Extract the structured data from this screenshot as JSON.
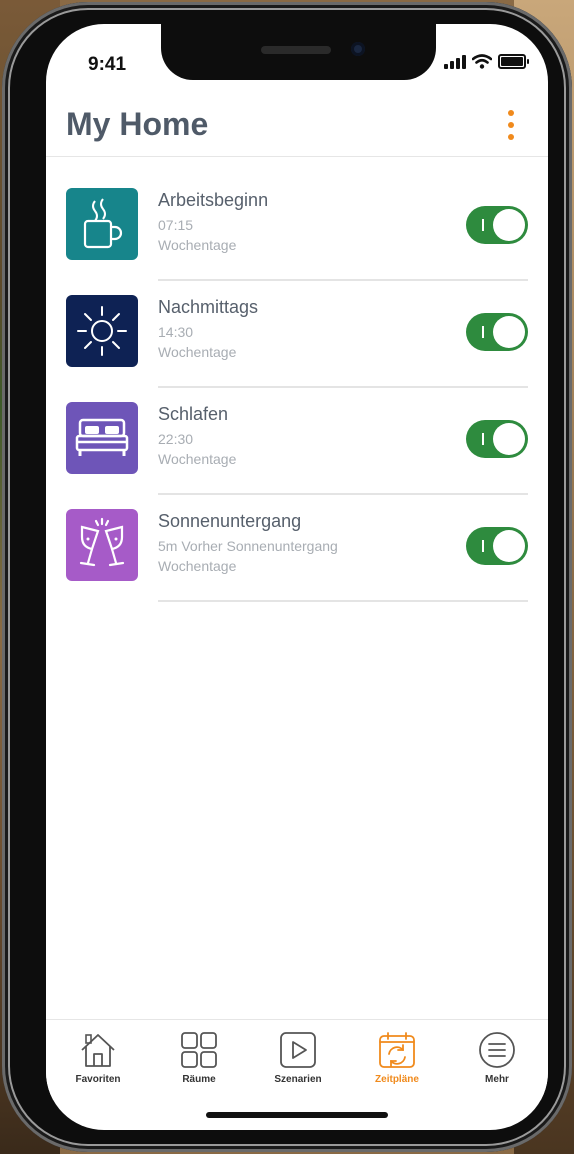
{
  "status_bar": {
    "time": "9:41"
  },
  "header": {
    "title": "My Home"
  },
  "colors": {
    "accent": "#f08a1c",
    "toggle_on": "#2e8b3e",
    "title": "#4f5a68"
  },
  "schedules": [
    {
      "title": "Arbeitsbeginn",
      "line1": "07:15",
      "line2": "Wochentage",
      "icon": "coffee-cup-icon",
      "color": "#17858b",
      "enabled": true
    },
    {
      "title": "Nachmittags",
      "line1": "14:30",
      "line2": "Wochentage",
      "icon": "sun-icon",
      "color": "#0e2254",
      "enabled": true
    },
    {
      "title": "Schlafen",
      "line1": "22:30",
      "line2": "Wochentage",
      "icon": "bed-icon",
      "color": "#6e55b8",
      "enabled": true
    },
    {
      "title": "Sonnenuntergang",
      "line1": "5m Vorher Sonnenuntergang",
      "line2": "Wochentage",
      "icon": "champagne-glasses-icon",
      "color": "#a65bc8",
      "enabled": true
    }
  ],
  "tabs": [
    {
      "label": "Favoriten",
      "icon": "house-icon",
      "active": false
    },
    {
      "label": "Räume",
      "icon": "grid-icon",
      "active": false
    },
    {
      "label": "Szenarien",
      "icon": "play-icon",
      "active": false
    },
    {
      "label": "Zeitpläne",
      "icon": "calendar-sync-icon",
      "active": true
    },
    {
      "label": "Mehr",
      "icon": "menu-circle-icon",
      "active": false
    }
  ]
}
